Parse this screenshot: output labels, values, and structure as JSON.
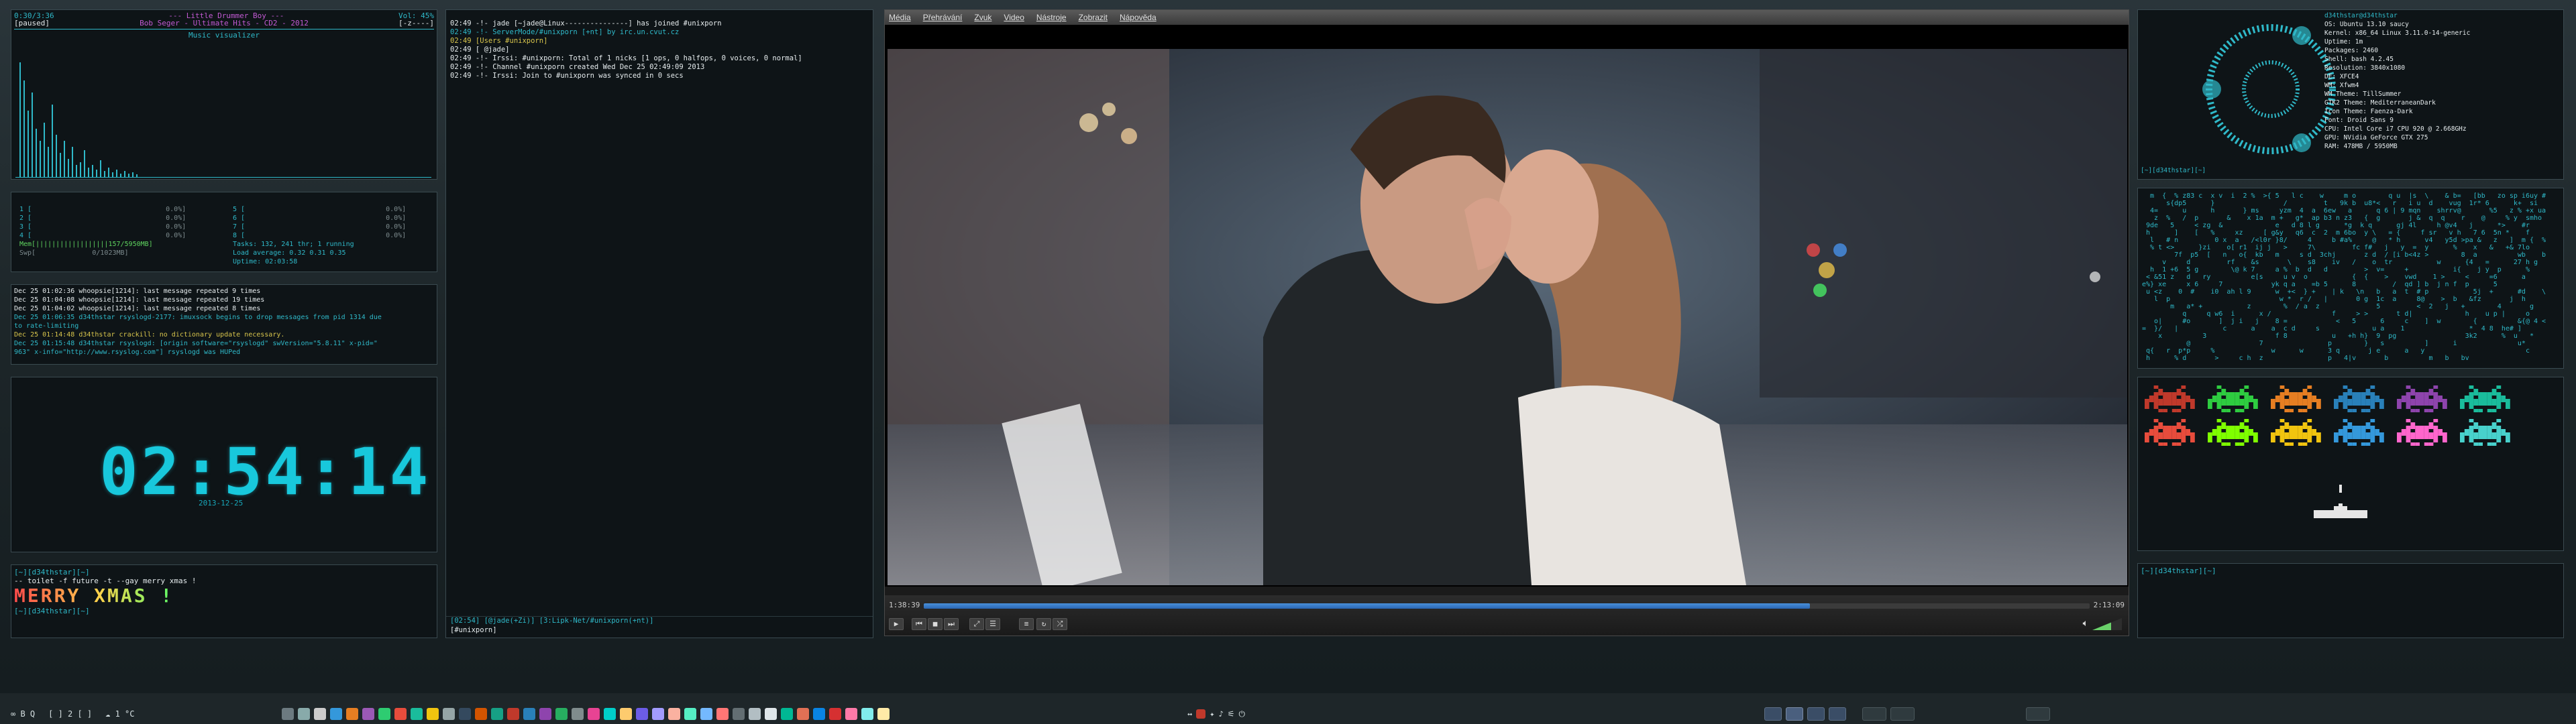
{
  "music": {
    "header_left": "0:30/3:36",
    "header_title": "--- Little Drummer Boy ---",
    "header_vol": "Vol: 45%",
    "artist_line": "Bob Seger - Ultimate Hits - CD2 - 2012",
    "status": "[paused]",
    "flags": "[-z----]",
    "visualizer_title": "Music visualizer",
    "spectrum": [
      0.95,
      0.8,
      0.55,
      0.7,
      0.4,
      0.3,
      0.45,
      0.25,
      0.6,
      0.35,
      0.2,
      0.3,
      0.15,
      0.25,
      0.1,
      0.12,
      0.22,
      0.08,
      0.1,
      0.06,
      0.14,
      0.05,
      0.08,
      0.04,
      0.06,
      0.03,
      0.05,
      0.03,
      0.04,
      0.02
    ]
  },
  "htop": {
    "cpu_rows": [
      "1 [",
      "2 [",
      "3 [",
      "4 ["
    ],
    "cpu_vals": [
      "0.0%]",
      "0.0%]",
      "0.0%]",
      "0.0%]"
    ],
    "cpu_rows2": [
      "5 [",
      "6 [",
      "7 [",
      "8 ["
    ],
    "cpu_vals2": [
      "0.0%]",
      "0.0%]",
      "0.0%]",
      "0.0%]"
    ],
    "mem": "Mem[||||||||||||||||||157/5950MB]",
    "swp": "Swp[              0/1023MB]",
    "tasks": "Tasks: 132, 241 thr; 1 running",
    "load": "Load average: 0.32 0.31 0.35",
    "uptime": "Uptime: 02:03:58"
  },
  "syslog": [
    "Dec 25 01:02:36 whoopsie[1214]: last message repeated 9 times",
    "Dec 25 01:04:08 whoopsie[1214]: last message repeated 19 times",
    "Dec 25 01:04:02 whoopsie[1214]: last message repeated 8 times",
    "Dec 25 01:06:35 d34thstar rsyslogd-2177: imuxsock begins to drop messages from pid 1314 due",
    "to rate-limiting",
    "Dec 25 01:14:48 d34thstar crackill: no dictionary update necessary.",
    "Dec 25 01:15:48 d34thstar rsyslogd: [origin software=\"rsyslogd\" swVersion=\"5.8.11\" x-pid=\"",
    "963\" x-info=\"http://www.rsyslog.com\"] rsyslogd was HUPed"
  ],
  "clock": {
    "time": "02:54:14",
    "date": "2013-12-25"
  },
  "toilet": {
    "prompt1": "[~][d34thstar][~]",
    "cmd": "-- toilet -f future -t --gay merry xmas !",
    "art": "MERRY XMAS !",
    "prompt2": "[~][d34thstar][~]"
  },
  "irc": {
    "lines": [
      "02:49 -!- jade [~jade@Linux---------------] has joined #unixporn",
      "02:49 -!- ServerMode/#unixporn [+nt] by irc.un.cvut.cz",
      "02:49 [Users #unixporn]",
      "02:49 [ @jade]",
      "02:49 -!- Irssi: #unixporn: Total of 1 nicks [1 ops, 0 halfops, 0 voices, 0 normal]",
      "02:49 -!- Channel #unixporn created Wed Dec 25 02:49:09 2013",
      "02:49 -!- Irssi: Join to #unixporn was synced in 0 secs"
    ],
    "statusbar": "[02:54] [@jade(+Zi)] [3:Lipk-Net/#unixporn(+nt)]",
    "input": "[#unixporn] "
  },
  "vlc": {
    "menu": [
      "Média",
      "Přehrávání",
      "Zvuk",
      "Video",
      "Nástroje",
      "Zobrazit",
      "Nápověda"
    ],
    "elapsed": "1:38:39",
    "total": "2:13:09",
    "progress": 0.76
  },
  "sysinfo": {
    "user_host": "d34thstar@d34thstar",
    "os": "OS: Ubuntu 13.10 saucy",
    "kernel": "Kernel: x86_64 Linux 3.11.0-14-generic",
    "uptime": "Uptime: 1m",
    "packages": "Packages: 2460",
    "shell": "Shell: bash 4.2.45",
    "resolution": "Resolution: 3840x1080",
    "de": "DE: XFCE4",
    "wm": "WM: Xfwm4",
    "wm_theme": "WM Theme: TillSummer",
    "gtk_theme": "GTK2 Theme: MediterraneanDark",
    "icon_theme": "Icon Theme: Faenza-Dark",
    "font": "Font: Droid Sans 9",
    "cpu": "CPU: Intel Core i7 CPU 920 @ 2.668GHz",
    "gpu": "GPU: NVidia GeForce GTX 275",
    "ram": "RAM: 478MB / 5950MB",
    "prompt": "[~][d34thstar][~]"
  },
  "prompt_bottom_right": "[~][d34thstar][~]",
  "taskbar": {
    "left": [
      "∞ B Q",
      "[ ] 2 [ ]",
      "☁ 1 °C"
    ],
    "colors": {
      "accent": "#2fb9c9",
      "taskbar": "#1e2629"
    }
  },
  "invaders": {
    "row1": [
      "#c0392b",
      "#2ecc40",
      "#e67e22",
      "#2980b9",
      "#8e44ad",
      "#1abc9c"
    ],
    "row2": [
      "#e74c3c",
      "#7fff00",
      "#f1c40f",
      "#3498db",
      "#ff66cc",
      "#48d1cc"
    ]
  }
}
